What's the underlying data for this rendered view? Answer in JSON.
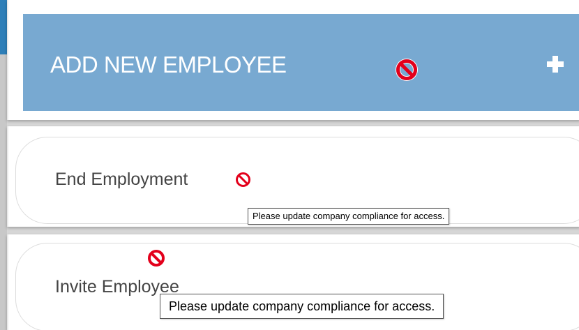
{
  "add_employee": {
    "label": "ADD NEW EMPLOYEE",
    "icon": "plus-icon",
    "blocked_icon": "no-access-icon",
    "accent_color": "#78a9d1"
  },
  "actions": [
    {
      "label": "End Employment",
      "blocked_icon": "no-access-icon",
      "tooltip": "Please update company compliance for access."
    },
    {
      "label": "Invite Employee",
      "blocked_icon": "no-access-icon",
      "tooltip": "Please update company compliance for access."
    }
  ],
  "colors": {
    "blocked": "#e3001b",
    "header_accent": "#2e7fb8"
  }
}
